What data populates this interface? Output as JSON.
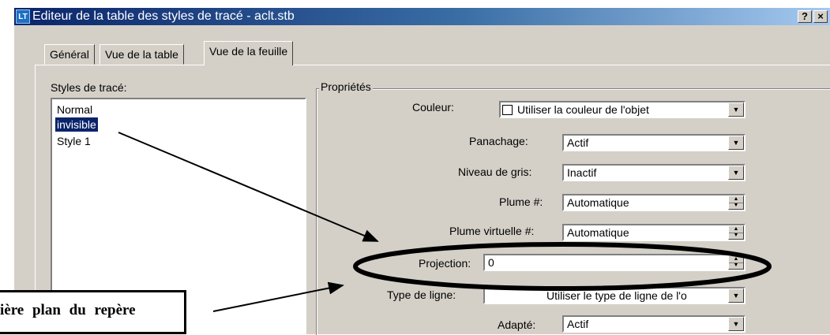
{
  "window": {
    "icon_text": "LT",
    "title": "Editeur de la table des styles de tracé - aclt.stb",
    "help_button": "?",
    "close_button": "×"
  },
  "tabs": [
    {
      "label": "Général",
      "active": false
    },
    {
      "label": "Vue de la table",
      "active": false
    },
    {
      "label": "Vue de la feuille",
      "active": true
    }
  ],
  "styles": {
    "label": "Styles de tracé:",
    "items": [
      "Normal",
      "invisible",
      "Style 1"
    ],
    "selected": "invisible"
  },
  "properties": {
    "title": "Propriétés",
    "color": {
      "label": "Couleur:",
      "value": "Utiliser la couleur de l'objet"
    },
    "dithering": {
      "label": "Panachage:",
      "value": "Actif"
    },
    "grayscale": {
      "label": "Niveau de gris:",
      "value": "Inactif"
    },
    "pen": {
      "label": "Plume #:",
      "value": "Automatique"
    },
    "virtual_pen": {
      "label": "Plume virtuelle #:",
      "value": "Automatique"
    },
    "screening": {
      "label": "Projection:",
      "value": "0"
    },
    "linetype": {
      "label": "Type de ligne:",
      "value": "Utiliser le type de ligne de l'o"
    },
    "adaptive": {
      "label": "Adapté:",
      "value": "Actif"
    }
  },
  "callout": {
    "text": "ière plan du repère"
  },
  "colors": {
    "dialog_bg": "#d4d0c8",
    "title_bar": "#0a246a",
    "selection": "#0a246a",
    "annotation": "#000000"
  }
}
